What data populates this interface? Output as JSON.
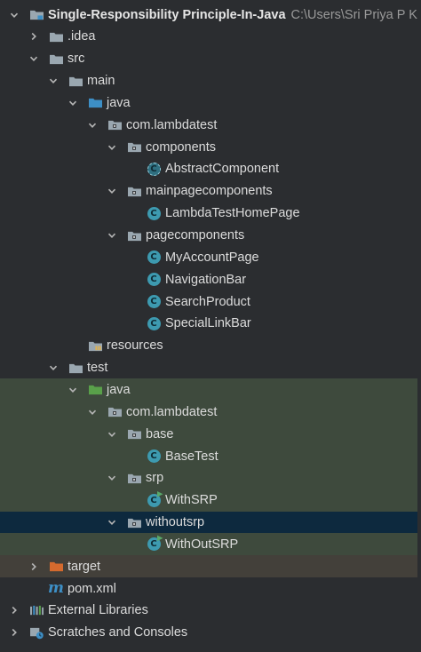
{
  "project": {
    "name": "Single-Responsibility Principle-In-Java",
    "path": "C:\\Users\\Sri Priya P Ku"
  },
  "tree": [
    {
      "label": "Single-Responsibility Principle-In-Java",
      "arrow": "down",
      "icon": "module-folder-icon",
      "depth": 0,
      "bold": true
    },
    {
      "label": ".idea",
      "arrow": "right",
      "icon": "folder-icon",
      "depth": 1
    },
    {
      "label": "src",
      "arrow": "down",
      "icon": "folder-icon",
      "depth": 1
    },
    {
      "label": "main",
      "arrow": "down",
      "icon": "folder-icon",
      "depth": 2
    },
    {
      "label": "java",
      "arrow": "down",
      "icon": "source-folder-icon",
      "depth": 3
    },
    {
      "label": "com.lambdatest",
      "arrow": "down",
      "icon": "package-icon",
      "depth": 4
    },
    {
      "label": "components",
      "arrow": "down",
      "icon": "package-icon",
      "depth": 5
    },
    {
      "label": "AbstractComponent",
      "arrow": "none",
      "icon": "abstract-class-icon",
      "depth": 6
    },
    {
      "label": "mainpagecomponents",
      "arrow": "down",
      "icon": "package-icon",
      "depth": 5
    },
    {
      "label": "LambdaTestHomePage",
      "arrow": "none",
      "icon": "class-icon",
      "depth": 6
    },
    {
      "label": "pagecomponents",
      "arrow": "down",
      "icon": "package-icon",
      "depth": 5
    },
    {
      "label": "MyAccountPage",
      "arrow": "none",
      "icon": "class-icon",
      "depth": 6
    },
    {
      "label": "NavigationBar",
      "arrow": "none",
      "icon": "class-icon",
      "depth": 6
    },
    {
      "label": "SearchProduct",
      "arrow": "none",
      "icon": "class-icon",
      "depth": 6
    },
    {
      "label": "SpecialLinkBar",
      "arrow": "none",
      "icon": "class-icon",
      "depth": 6
    },
    {
      "label": "resources",
      "arrow": "none",
      "icon": "resources-folder-icon",
      "depth": 3
    },
    {
      "label": "test",
      "arrow": "down",
      "icon": "folder-icon",
      "depth": 2
    },
    {
      "label": "java",
      "arrow": "down",
      "icon": "test-source-folder-icon",
      "depth": 3,
      "bg": "green"
    },
    {
      "label": "com.lambdatest",
      "arrow": "down",
      "icon": "package-icon",
      "depth": 4,
      "bg": "green"
    },
    {
      "label": "base",
      "arrow": "down",
      "icon": "package-icon",
      "depth": 5,
      "bg": "green"
    },
    {
      "label": "BaseTest",
      "arrow": "none",
      "icon": "class-icon",
      "depth": 6,
      "bg": "green"
    },
    {
      "label": "srp",
      "arrow": "down",
      "icon": "package-icon",
      "depth": 5,
      "bg": "green"
    },
    {
      "label": "WithSRP",
      "arrow": "none",
      "icon": "test-class-icon",
      "depth": 6,
      "bg": "green"
    },
    {
      "label": "withoutsrp",
      "arrow": "down",
      "icon": "package-icon",
      "depth": 5,
      "bg": "selected"
    },
    {
      "label": "WithOutSRP",
      "arrow": "none",
      "icon": "test-class-icon",
      "depth": 6,
      "bg": "green"
    },
    {
      "label": "target",
      "arrow": "right",
      "icon": "excluded-folder-icon",
      "depth": 1,
      "bg": "brown"
    },
    {
      "label": "pom.xml",
      "arrow": "none",
      "icon": "maven-icon",
      "depth": 1
    },
    {
      "label": "External Libraries",
      "arrow": "right",
      "icon": "libraries-icon",
      "depth": 0
    },
    {
      "label": "Scratches and Consoles",
      "arrow": "right",
      "icon": "scratches-icon",
      "depth": 0
    }
  ],
  "colors": {
    "background": "#2b2d30",
    "test_bg": "#3e4a3d",
    "selected_bg": "#0d293e",
    "excluded_bg": "#43403a",
    "folder": "#9aa7b0",
    "source_folder": "#3d8fc6",
    "test_folder": "#59a04a",
    "excluded_folder": "#d46a2e",
    "class": "#3d9ab0"
  }
}
